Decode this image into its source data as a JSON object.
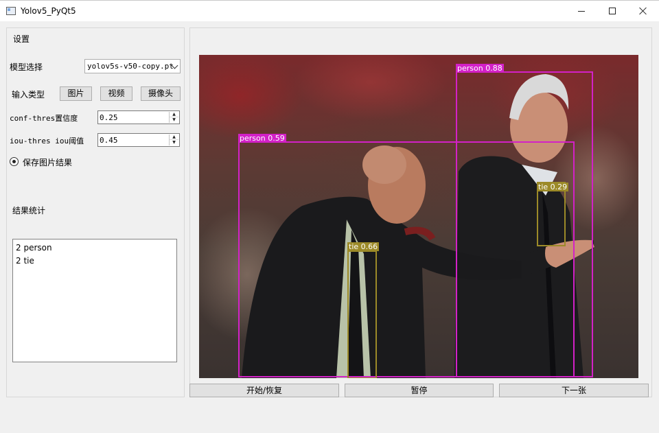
{
  "window": {
    "title": "Yolov5_PyQt5"
  },
  "settings": {
    "group_title": "设置",
    "model_label": "模型选择",
    "model_value": "yolov5s-v50-copy.pt",
    "input_type_label": "输入类型",
    "input_buttons": [
      "图片",
      "视频",
      "摄像头"
    ],
    "conf_label": "conf-thres置信度",
    "conf_value": "0.25",
    "iou_label": "iou-thres iou阈值",
    "iou_value": "0.45",
    "save_label": "保存图片结果"
  },
  "results": {
    "group_title": "结果统计",
    "lines": [
      "2 person",
      "2 tie"
    ]
  },
  "detections": [
    {
      "label": "person 0.88",
      "color": "#d321c7"
    },
    {
      "label": "person 0.59",
      "color": "#d321c7"
    },
    {
      "label": "tie 0.29",
      "color": "#9c8a28"
    },
    {
      "label": "tie 0.66",
      "color": "#9c8a28"
    }
  ],
  "controls": {
    "start_resume": "开始/恢复",
    "pause": "暂停",
    "next": "下一张"
  }
}
